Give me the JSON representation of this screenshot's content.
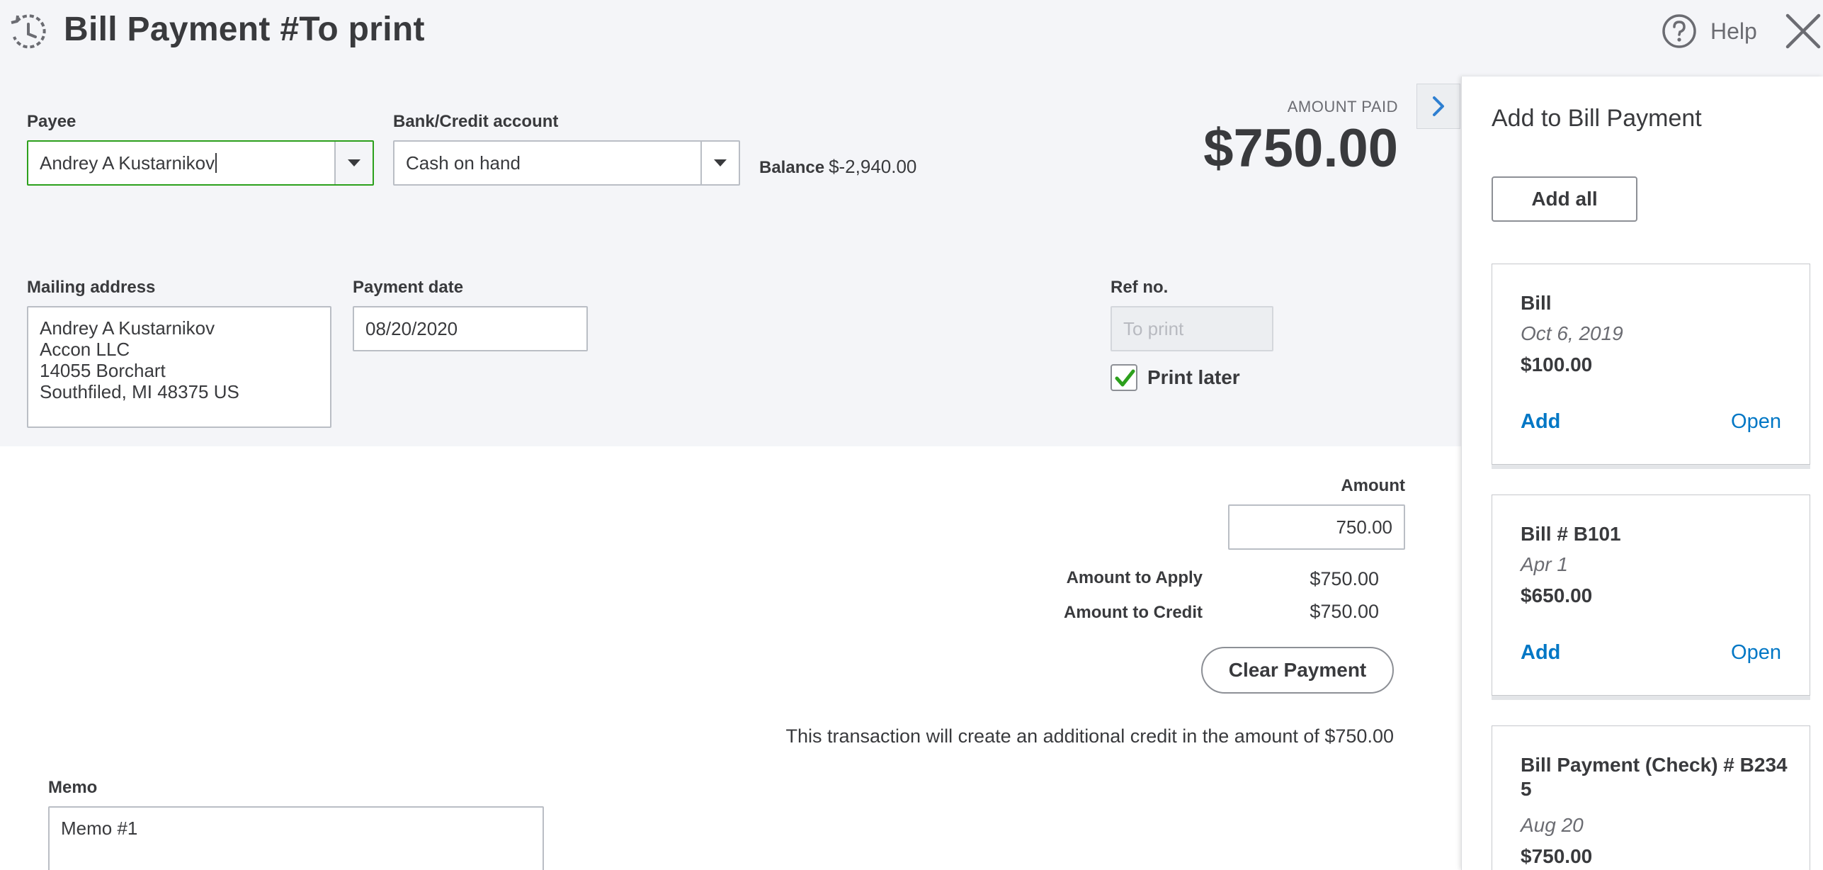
{
  "header": {
    "title": "Bill Payment #To print",
    "help_label": "Help"
  },
  "payee": {
    "label": "Payee",
    "value": "Andrey A Kustarnikov"
  },
  "bank_account": {
    "label": "Bank/Credit account",
    "value": "Cash on hand"
  },
  "balance": {
    "label": "Balance",
    "value": "$-2,940.00"
  },
  "amount_paid": {
    "label": "AMOUNT PAID",
    "value": "$750.00"
  },
  "mailing_address": {
    "label": "Mailing address",
    "lines": [
      "Andrey A Kustarnikov",
      "Accon LLC",
      "14055 Borchart",
      "Southfiled, MI  48375 US"
    ]
  },
  "payment_date": {
    "label": "Payment date",
    "value": "08/20/2020"
  },
  "ref_no": {
    "label": "Ref no.",
    "placeholder": "To print"
  },
  "print_later": {
    "label": "Print later",
    "checked": true
  },
  "amount": {
    "label": "Amount",
    "value": "750.00"
  },
  "summary": {
    "apply_label": "Amount to Apply",
    "apply_value": "$750.00",
    "credit_label": "Amount to Credit",
    "credit_value": "$750.00"
  },
  "clear_payment_label": "Clear Payment",
  "credit_note": "This transaction will create an additional credit in the amount of $750.00",
  "memo": {
    "label": "Memo",
    "value": "Memo #1"
  },
  "drawer": {
    "title": "Add to Bill Payment",
    "add_all_label": "Add all",
    "cards": [
      {
        "title": "Bill",
        "date": "Oct 6, 2019",
        "amount": "$100.00",
        "add_label": "Add",
        "open_label": "Open"
      },
      {
        "title": "Bill # B101",
        "date": "Apr 1",
        "amount": "$650.00",
        "add_label": "Add",
        "open_label": "Open"
      },
      {
        "title_line1": "Bill Payment (Check) # B234",
        "title_line2": "5",
        "date": "Aug 20",
        "amount": "$750.00"
      }
    ]
  },
  "colors": {
    "accent_green": "#2ca01c",
    "link_blue": "#0077c5",
    "text": "#393a3d",
    "band_gray": "#f4f5f8"
  },
  "icons": [
    "recent-transactions-icon",
    "help-circle-icon",
    "close-icon",
    "chevron-right-icon",
    "chevron-down-icon",
    "checkmark-icon"
  ]
}
